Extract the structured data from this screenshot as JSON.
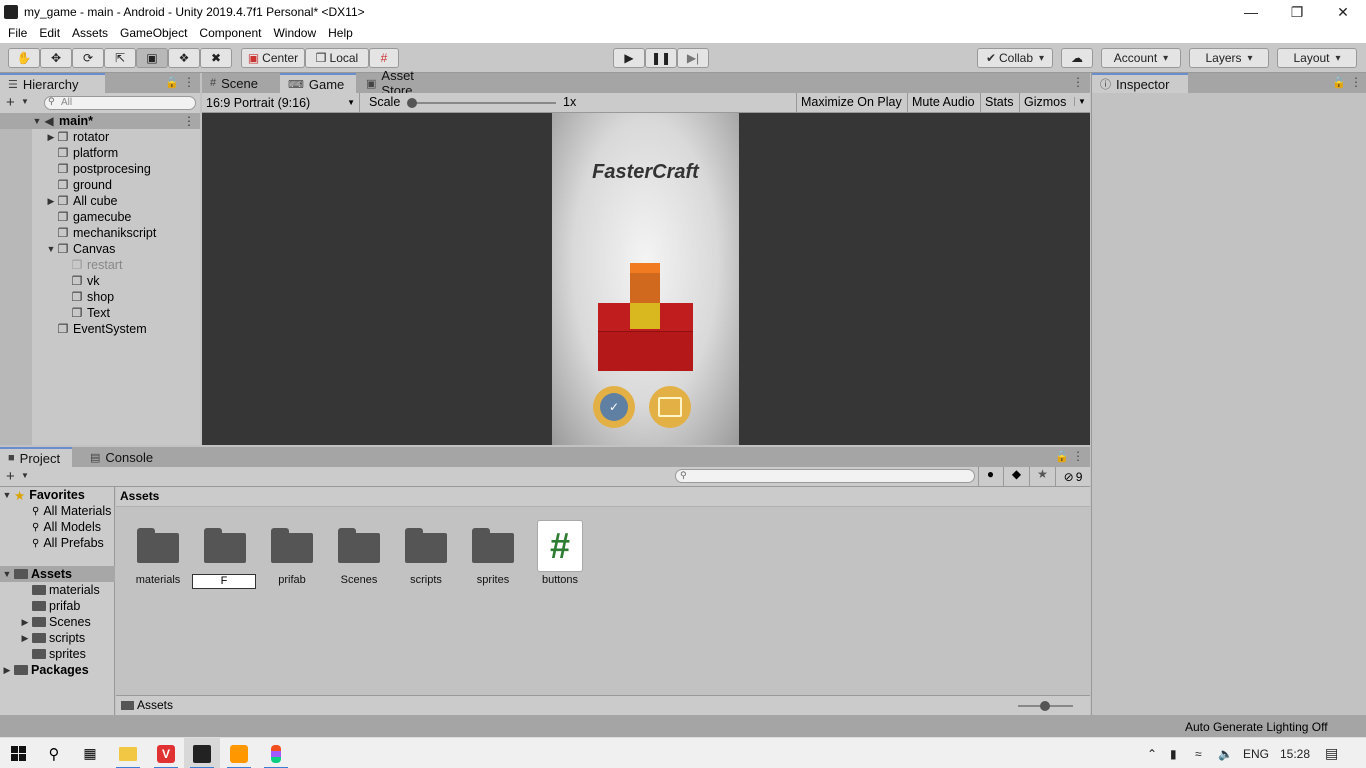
{
  "window": {
    "title": "my_game - main - Android - Unity 2019.4.7f1 Personal* <DX11>"
  },
  "menu": [
    "File",
    "Edit",
    "Assets",
    "GameObject",
    "Component",
    "Window",
    "Help"
  ],
  "toolbar": {
    "pivot_label": "Center",
    "space_label": "Local",
    "collab_label": "Collab",
    "account_label": "Account",
    "layers_label": "Layers",
    "layout_label": "Layout"
  },
  "hierarchy": {
    "tab_label": "Hierarchy",
    "search_placeholder": "All",
    "scene_name": "main*",
    "items": [
      {
        "label": "rotator",
        "arrow": "▶"
      },
      {
        "label": "platform",
        "arrow": ""
      },
      {
        "label": "postprocesing",
        "arrow": ""
      },
      {
        "label": "ground",
        "arrow": ""
      },
      {
        "label": "All cube",
        "arrow": "▶"
      },
      {
        "label": "gamecube",
        "arrow": ""
      },
      {
        "label": "mechanikscript",
        "arrow": ""
      },
      {
        "label": "Canvas",
        "arrow": "▼"
      },
      {
        "label": "restart",
        "arrow": ""
      },
      {
        "label": "vk",
        "arrow": ""
      },
      {
        "label": "shop",
        "arrow": ""
      },
      {
        "label": "Text",
        "arrow": ""
      },
      {
        "label": "EventSystem",
        "arrow": ""
      }
    ]
  },
  "center_tabs": {
    "scene": "Scene",
    "game": "Game",
    "asset_store": "Asset Store"
  },
  "game_toolbar": {
    "aspect": "16:9 Portrait (9:16)",
    "scale_label": "Scale",
    "scale_value": "1x",
    "maximize": "Maximize On Play",
    "mute": "Mute Audio",
    "stats": "Stats",
    "gizmos": "Gizmos"
  },
  "game": {
    "title": "FasterCraft"
  },
  "inspector": {
    "tab_label": "Inspector"
  },
  "project": {
    "tab_label": "Project",
    "console_label": "Console",
    "hidden_count": "9",
    "favorites_label": "Favorites",
    "favorites": [
      "All Materials",
      "All Models",
      "All Prefabs"
    ],
    "assets_root": "Assets",
    "asset_tree": [
      {
        "label": "materials",
        "arrow": ""
      },
      {
        "label": "prifab",
        "arrow": ""
      },
      {
        "label": "Scenes",
        "arrow": "▶"
      },
      {
        "label": "scripts",
        "arrow": "▶"
      },
      {
        "label": "sprites",
        "arrow": ""
      }
    ],
    "packages_label": "Packages",
    "breadcrumb": "Assets",
    "rename_value": "F",
    "assets": [
      {
        "label": "materials"
      },
      {
        "label": ""
      },
      {
        "label": "prifab"
      },
      {
        "label": "Scenes"
      },
      {
        "label": "scripts"
      },
      {
        "label": "sprites"
      },
      {
        "label": "buttons"
      }
    ],
    "footer_path": "Assets"
  },
  "status": {
    "lighting": "Auto Generate Lighting Off"
  },
  "taskbar": {
    "lang": "ENG",
    "time": "15:28"
  },
  "colors": {
    "tab_accent": "#6a8dce",
    "script_green": "#2e7d32",
    "button_gold": "#e2b044",
    "vk_blue": "#5f7fa3"
  }
}
